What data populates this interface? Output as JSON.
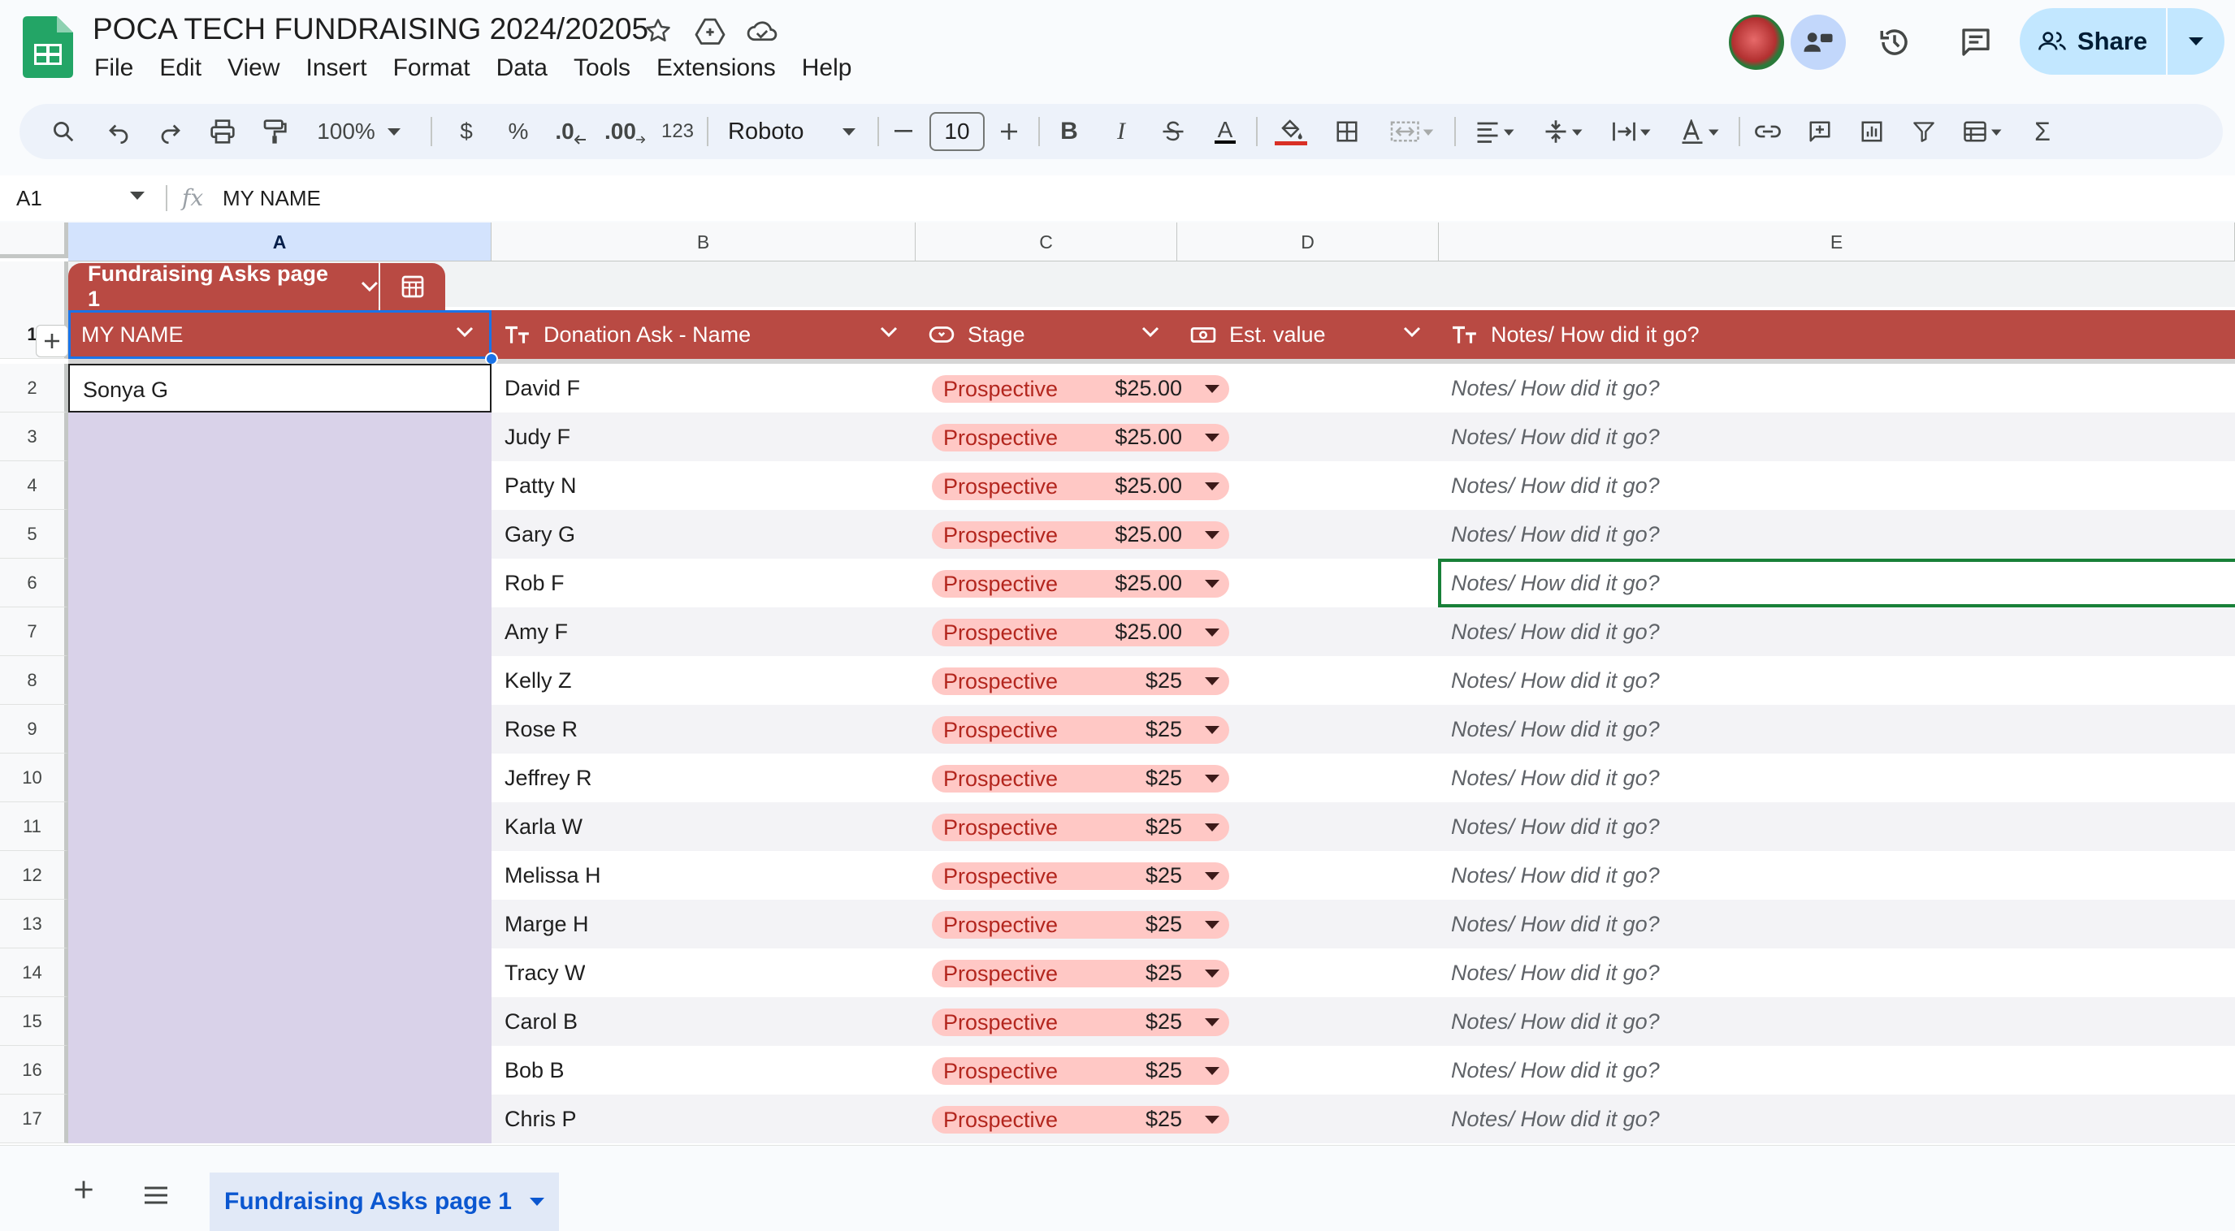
{
  "app": {
    "doc_title": "POCA TECH FUNDRAISING 2024/20205",
    "menu": [
      "File",
      "Edit",
      "View",
      "Insert",
      "Format",
      "Data",
      "Tools",
      "Extensions",
      "Help"
    ],
    "share_label": "Share"
  },
  "toolbar": {
    "zoom": "100%",
    "currency": "$",
    "percent": "%",
    "decrease_decimals": ".0",
    "increase_decimals": ".00",
    "number_format": "123",
    "font": "Roboto",
    "font_size": "10",
    "bold": "B",
    "italic": "I",
    "text_color": "A",
    "sum": "Σ"
  },
  "formula_bar": {
    "cell_ref": "A1",
    "fx": "fx",
    "content": "MY NAME"
  },
  "columns": [
    "A",
    "B",
    "C",
    "D",
    "E"
  ],
  "table": {
    "name": "Fundraising Asks page 1",
    "headers": {
      "a": "MY NAME",
      "b": "Donation Ask -  Name",
      "c": "Stage",
      "d": "Est. value",
      "e": "Notes/ How did it go?"
    },
    "header_row_num": "1",
    "rows": [
      {
        "num": "2",
        "my_name": "Sonya G",
        "donor": "David F",
        "stage": "Prospective",
        "value": "$25.00",
        "notes": "Notes/ How did it go?"
      },
      {
        "num": "3",
        "my_name": "",
        "donor": "Judy F",
        "stage": "Prospective",
        "value": "$25.00",
        "notes": "Notes/ How did it go?"
      },
      {
        "num": "4",
        "my_name": "",
        "donor": "Patty N",
        "stage": "Prospective",
        "value": "$25.00",
        "notes": "Notes/ How did it go?"
      },
      {
        "num": "5",
        "my_name": "",
        "donor": "Gary G",
        "stage": "Prospective",
        "value": "$25.00",
        "notes": "Notes/ How did it go?"
      },
      {
        "num": "6",
        "my_name": "",
        "donor": "Rob F",
        "stage": "Prospective",
        "value": "$25.00",
        "notes": "Notes/ How did it go?"
      },
      {
        "num": "7",
        "my_name": "",
        "donor": "Amy F",
        "stage": "Prospective",
        "value": "$25.00",
        "notes": "Notes/ How did it go?"
      },
      {
        "num": "8",
        "my_name": "",
        "donor": "Kelly Z",
        "stage": "Prospective",
        "value": "$25",
        "notes": "Notes/ How did it go?"
      },
      {
        "num": "9",
        "my_name": "",
        "donor": "Rose R",
        "stage": "Prospective",
        "value": "$25",
        "notes": "Notes/ How did it go?"
      },
      {
        "num": "10",
        "my_name": "",
        "donor": "Jeffrey R",
        "stage": "Prospective",
        "value": "$25",
        "notes": "Notes/ How did it go?"
      },
      {
        "num": "11",
        "my_name": "",
        "donor": "Karla W",
        "stage": "Prospective",
        "value": "$25",
        "notes": "Notes/ How did it go?"
      },
      {
        "num": "12",
        "my_name": "",
        "donor": "Melissa H",
        "stage": "Prospective",
        "value": "$25",
        "notes": "Notes/ How did it go?"
      },
      {
        "num": "13",
        "my_name": "",
        "donor": "Marge H",
        "stage": "Prospective",
        "value": "$25",
        "notes": "Notes/ How did it go?"
      },
      {
        "num": "14",
        "my_name": "",
        "donor": "Tracy W",
        "stage": "Prospective",
        "value": "$25",
        "notes": "Notes/ How did it go?"
      },
      {
        "num": "15",
        "my_name": "",
        "donor": "Carol B",
        "stage": "Prospective",
        "value": "$25",
        "notes": "Notes/ How did it go?"
      },
      {
        "num": "16",
        "my_name": "",
        "donor": "Bob B",
        "stage": "Prospective",
        "value": "$25",
        "notes": "Notes/ How did it go?"
      },
      {
        "num": "17",
        "my_name": "",
        "donor": "Chris P",
        "stage": "Prospective",
        "value": "$25",
        "notes": "Notes/ How did it go?"
      }
    ]
  },
  "sheet_tabs": [
    "Fundraising Asks page 1"
  ],
  "colors": {
    "table_header": "#b94a43",
    "stage_chip": "#ffc8c5",
    "my_name_column": "#d9d2e9",
    "selection": "#1a73e8",
    "share_button": "#c2e7ff"
  }
}
